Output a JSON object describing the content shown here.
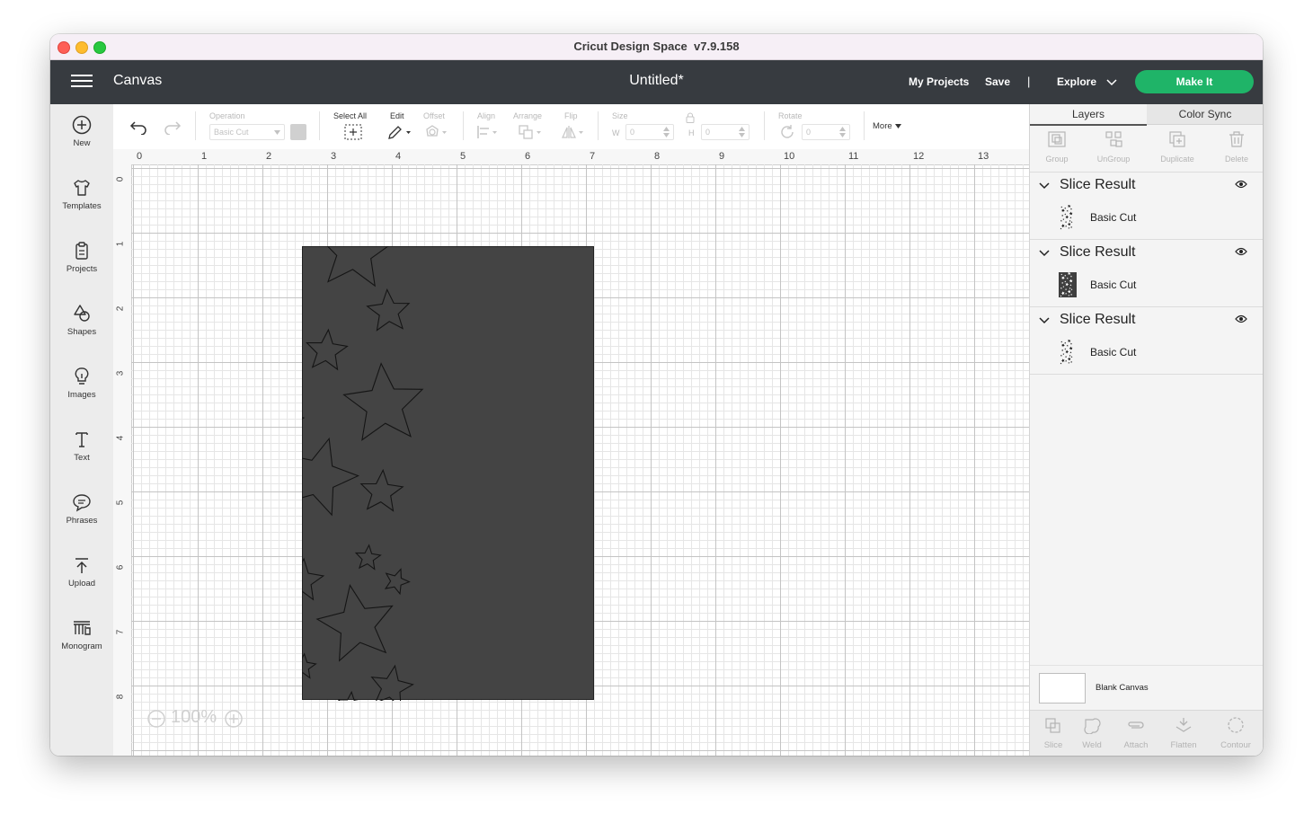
{
  "window": {
    "title": "Cricut Design Space  v7.9.158"
  },
  "header": {
    "section": "Canvas",
    "document": "Untitled*",
    "my_projects": "My Projects",
    "save": "Save",
    "separator": "|",
    "explore": "Explore",
    "make_it": "Make It"
  },
  "leftnav": {
    "items": [
      {
        "label": "New",
        "icon": "plus-circle-icon"
      },
      {
        "label": "Templates",
        "icon": "tshirt-icon"
      },
      {
        "label": "Projects",
        "icon": "clipboard-icon"
      },
      {
        "label": "Shapes",
        "icon": "shapes-icon"
      },
      {
        "label": "Images",
        "icon": "lightbulb-icon"
      },
      {
        "label": "Text",
        "icon": "text-icon"
      },
      {
        "label": "Phrases",
        "icon": "speech-bubble-icon"
      },
      {
        "label": "Upload",
        "icon": "upload-icon"
      },
      {
        "label": "Monogram",
        "icon": "monogram-icon"
      }
    ]
  },
  "toolbar": {
    "operation_label": "Operation",
    "operation_value": "Basic Cut",
    "select_all": "Select All",
    "edit": "Edit",
    "offset": "Offset",
    "align": "Align",
    "arrange": "Arrange",
    "flip": "Flip",
    "size": "Size",
    "w_label": "W",
    "w_value": "0",
    "h_label": "H",
    "h_value": "0",
    "rotate": "Rotate",
    "rotate_value": "0",
    "more": "More"
  },
  "canvas": {
    "ruler_top": [
      "0",
      "1",
      "2",
      "3",
      "4",
      "5",
      "6",
      "7",
      "8",
      "9",
      "10",
      "11",
      "12",
      "13"
    ],
    "ruler_left": [
      "0",
      "1",
      "2",
      "3",
      "4",
      "5",
      "6",
      "7",
      "8"
    ],
    "zoom_value": "100%",
    "mat_color": "#444444",
    "stars": [
      {
        "cx": 1.53,
        "cy": 1.61,
        "r": 0.2,
        "rot": -8
      },
      {
        "cx": 3.42,
        "cy": 1.29,
        "r": 0.62,
        "rot": 5
      },
      {
        "cx": 2.42,
        "cy": 1.97,
        "r": 0.2,
        "rot": -6
      },
      {
        "cx": 3.95,
        "cy": 2.22,
        "r": 0.34,
        "rot": -4
      },
      {
        "cx": 1.88,
        "cy": 2.71,
        "r": 0.64,
        "rot": 30
      },
      {
        "cx": 2.99,
        "cy": 2.83,
        "r": 0.33,
        "rot": 5
      },
      {
        "cx": 3.88,
        "cy": 3.66,
        "r": 0.64,
        "rot": -4
      },
      {
        "cx": 2.44,
        "cy": 3.89,
        "r": 0.2,
        "rot": 10
      },
      {
        "cx": 1.73,
        "cy": 4.31,
        "r": 0.34,
        "rot": 20
      },
      {
        "cx": 2.86,
        "cy": 4.78,
        "r": 0.62,
        "rot": 16
      },
      {
        "cx": 3.84,
        "cy": 5.01,
        "r": 0.34,
        "rot": 4
      },
      {
        "cx": 1.99,
        "cy": 5.51,
        "r": 0.2,
        "rot": -6
      },
      {
        "cx": 1.43,
        "cy": 6.0,
        "r": 0.34,
        "rot": -10
      },
      {
        "cx": 3.63,
        "cy": 6.03,
        "r": 0.2,
        "rot": 5
      },
      {
        "cx": 2.61,
        "cy": 6.38,
        "r": 0.34,
        "rot": 5
      },
      {
        "cx": 4.07,
        "cy": 6.39,
        "r": 0.2,
        "rot": 20
      },
      {
        "cx": 3.46,
        "cy": 7.06,
        "r": 0.62,
        "rot": -10
      },
      {
        "cx": 1.88,
        "cy": 7.57,
        "r": 0.64,
        "rot": -18
      },
      {
        "cx": 2.63,
        "cy": 7.71,
        "r": 0.2,
        "rot": 5
      },
      {
        "cx": 3.99,
        "cy": 8.03,
        "r": 0.34,
        "rot": 10
      },
      {
        "cx": 3.36,
        "cy": 8.3,
        "r": 0.2,
        "rot": 5
      },
      {
        "cx": 1.35,
        "cy": 8.48,
        "r": 0.2,
        "rot": 3
      }
    ]
  },
  "panel": {
    "tabs": [
      "Layers",
      "Color Sync"
    ],
    "tools": [
      "Group",
      "UnGroup",
      "Duplicate",
      "Delete"
    ],
    "layers": [
      {
        "title": "Slice Result",
        "operation": "Basic Cut",
        "thumb": "light"
      },
      {
        "title": "Slice Result",
        "operation": "Basic Cut",
        "thumb": "dark"
      },
      {
        "title": "Slice Result",
        "operation": "Basic Cut",
        "thumb": "light"
      }
    ],
    "blank_canvas": "Blank Canvas",
    "bottom_tools": [
      "Slice",
      "Weld",
      "Attach",
      "Flatten",
      "Contour"
    ]
  },
  "colors": {
    "header_bg": "#373b40",
    "make_it": "#1fb468",
    "mat": "#444444"
  }
}
